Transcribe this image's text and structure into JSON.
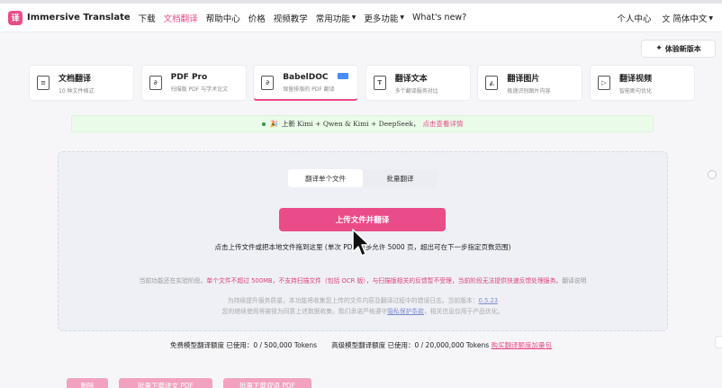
{
  "nav": {
    "logo_mark": "译",
    "brand": "Immersive Translate",
    "links": [
      "下载",
      "文档翻译",
      "帮助中心",
      "价格",
      "视频教学"
    ],
    "dropdown_links": [
      "常用功能",
      "更多功能"
    ],
    "whats_new": "What's new?",
    "user_center": "个人中心",
    "language": "简体中文"
  },
  "try_new_version": "体验新版本",
  "cards": [
    {
      "title": "文档翻译",
      "subtitle": "10 种文件格式",
      "icon": "document-icon"
    },
    {
      "title": "PDF Pro",
      "subtitle": "扫描版 PDF 与学术论文",
      "icon": "pdf-icon"
    },
    {
      "title": "BabelDOC",
      "subtitle": "保留排版的 PDF 翻译",
      "icon": "pdf-icon"
    },
    {
      "title": "翻译文本",
      "subtitle": "多个翻译服务对比",
      "icon": "text-icon"
    },
    {
      "title": "翻译图片",
      "subtitle": "极速识别图片内容",
      "icon": "image-icon"
    },
    {
      "title": "翻译视频",
      "subtitle": "智能断句优化",
      "icon": "video-icon"
    }
  ],
  "banner": {
    "text": "上新 Kimi + Qwen & Kimi + DeepSeek，",
    "link": "点击查看详情"
  },
  "upload": {
    "tab_single": "翻译单个文件",
    "tab_batch": "批量翻译",
    "button": "上传文件并翻译",
    "hint": "点击上传文件或把本地文件拖到这里 (单次 PDF 最多允许 5000 页，超出可在下一步指定页数范围)",
    "notice_prefix": "当前功能还在实验阶段。",
    "notice_highlight": "单个文件不超过 500MB，不支持扫描文件（包括 OCR 版），与扫描版相关的反馈暂不受理，当前阶段无法提供快速反馈处理服务。",
    "notice_suffix": "翻译说明",
    "privacy_line1": "为持续提升服务质量，本功能将收集您上传的文件内容及翻译过程中的错误日志。当前版本：",
    "version": "0.5.23",
    "privacy_line2_prefix": "您的继续使用将被视为同意上述数据收集。我们承诺严格遵守",
    "privacy_link": "隐私保护条款",
    "privacy_line2_suffix": "，相关信息仅用于产品优化。"
  },
  "quota": {
    "free": "免费模型翻译额度 已使用：0 / 500,000 Tokens",
    "advanced": "高级模型翻译额度 已使用：0 / 20,000,000 Tokens",
    "buy": "购买翻译额度加量包"
  },
  "bottom_buttons": [
    "删除",
    "批量下载译文 PDF",
    "批量下载双语 PDF"
  ],
  "colors": {
    "accent": "#ea4c89",
    "banner_bg": "#eafbe9",
    "panel_bg": "#eef0f6",
    "badge": "#4a8cf7"
  }
}
